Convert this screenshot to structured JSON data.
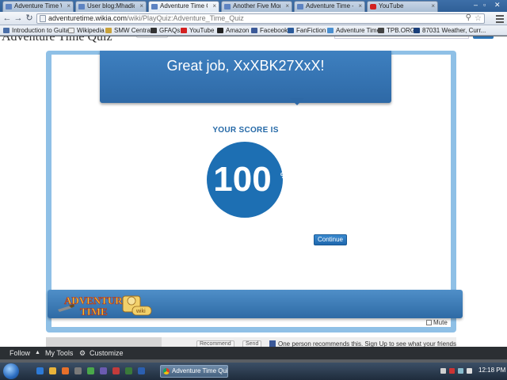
{
  "browser": {
    "tabs": [
      {
        "label": "Adventure Time Wik",
        "icon": "wikia-icon"
      },
      {
        "label": "User blog:Mhadick/T",
        "icon": "wikia-icon"
      },
      {
        "label": "Adventure Time Quiz",
        "icon": "wikia-icon",
        "active": true
      },
      {
        "label": "Another Five More S",
        "icon": "wikia-icon"
      },
      {
        "label": "Adventure Time - Th",
        "icon": "wikia-icon"
      },
      {
        "label": "YouTube",
        "icon": "youtube-icon"
      }
    ],
    "url_host": "adventuretime.wikia.com",
    "url_path": "/wiki/PlayQuiz:Adventure_Time_Quiz",
    "bookmarks": [
      "Introduction to Guitar",
      "Wikipedia",
      "SMW Central",
      "GFAQs",
      "YouTube",
      "Amazon",
      "Facebook",
      "FanFiction",
      "Adventure Time",
      "TPB.ORG",
      "87031 Weather, Curr..."
    ]
  },
  "page": {
    "title": "Adventure Time Quiz"
  },
  "quiz": {
    "banner_text": "Great job, XxXBK27XxX!",
    "score_label": "YOUR SCORE IS",
    "score_value": "100",
    "score_unit": "%",
    "continue_label": "Continue",
    "logo_text": "ADVENTURE TIME",
    "logo_badge": "wiki",
    "mute_label": "Mute"
  },
  "social": {
    "recommend_label": "Recommend",
    "send_label": "Send",
    "fb_text": "One person recommends this. Sign Up to see what your friends"
  },
  "wikia_toolbar": {
    "follow": "Follow",
    "my_tools": "My Tools",
    "customize": "Customize"
  },
  "taskbar": {
    "task_label": "Adventure Time Qui...",
    "clock": "12:18 PM"
  },
  "colors": {
    "accent_blue": "#1d6fb3",
    "banner_blue": "#2e69a6",
    "frame_light_blue": "#8fc0e6"
  }
}
